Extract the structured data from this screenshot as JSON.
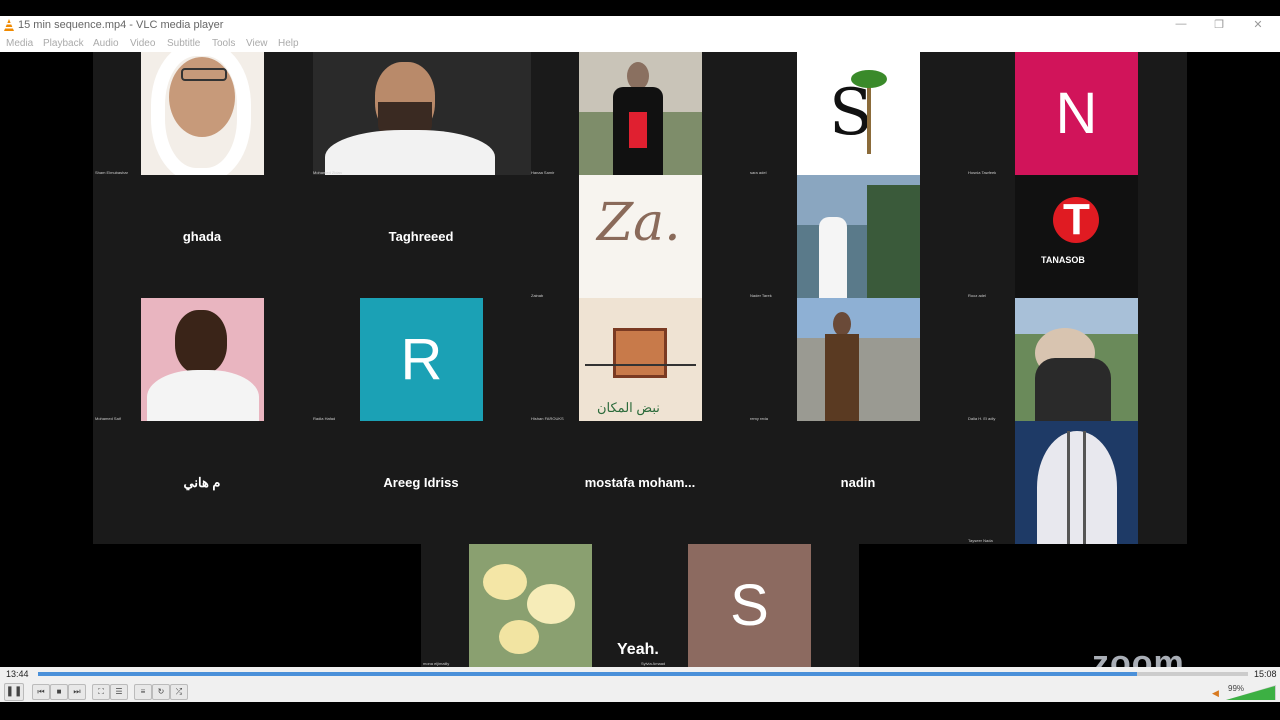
{
  "window": {
    "title": "15 min sequence.mp4 - VLC media player"
  },
  "menu": [
    "Media",
    "Playback",
    "Audio",
    "Video",
    "Subtitle",
    "Tools",
    "View",
    "Help"
  ],
  "tiles": {
    "ghada": "ghada",
    "taghreeed": "Taghreeed",
    "m_hani": "م هاني",
    "areeg": "Areeg Idriss",
    "mostafa": "mostafa  moham...",
    "nadin": "nadin",
    "n_initial": "N",
    "r_initial": "R",
    "s_initial": "S",
    "caption": "Yeah.",
    "tanasob": "TANASOB",
    "arabic_logo": "نبض المكان",
    "za_logo": "Za."
  },
  "small_names": [
    "Sham Elmubashar",
    "Mohamed Zidan",
    "Hanaa Samir",
    "sara adel",
    "Hosnia Tawfeek",
    "Zainab",
    "Nader Tarek",
    "Rooz adel",
    "Mohamed Saif",
    "Radia Hafad",
    "Hishan FAROUKS",
    "remy reda",
    "Dalia H. El adly",
    "Tayseer Nada",
    "mona eljimaiily",
    "Sylvia Amaad"
  ],
  "player": {
    "time_current": "13:44",
    "time_total": "15:08",
    "progress": 0.908,
    "volume": "99%"
  },
  "watermark": "zoom",
  "colors": {
    "accent": "#4a90d9",
    "n_tile": "#d1145a",
    "r_tile": "#1ba1b5",
    "s_tile": "#8c6a60"
  }
}
